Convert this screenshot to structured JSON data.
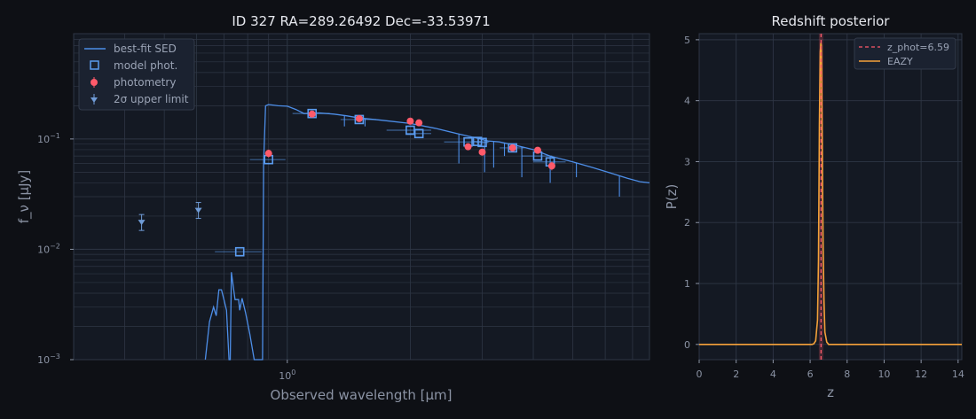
{
  "colors": {
    "background": "#0e1015",
    "axes_bg": "#141923",
    "grid": "#2e3645",
    "text": "#8b93a4",
    "sed": "#4d8ee8",
    "model_phot": "#5b9cf0",
    "photometry": "#ff5a6a",
    "upper_limit": "#6f9bd6",
    "zphot_line": "#ff5a6a",
    "eazy": "#f6a23a"
  },
  "chart_data": [
    {
      "type": "scatter",
      "title": "ID 327  RA=289.26492  Dec=-33.53971",
      "xlabel": "Observed wavelength [µm]",
      "ylabel": "f_ν [µJy]",
      "xscale": "log",
      "yscale": "log",
      "xlim": [
        0.3,
        7.7
      ],
      "ylim": [
        0.001,
        0.9
      ],
      "x_tick_labels": [
        "10^0"
      ],
      "y_tick_labels": [
        "10^-3",
        "10^-2",
        "10^-1"
      ],
      "grid": true,
      "legend": {
        "position": "top-left",
        "entries": [
          "best-fit SED",
          "model phot.",
          "photometry",
          "2σ upper limit"
        ]
      },
      "sed_line": [
        [
          0.63,
          0.001
        ],
        [
          0.645,
          0.0022
        ],
        [
          0.66,
          0.003
        ],
        [
          0.67,
          0.0025
        ],
        [
          0.68,
          0.0043
        ],
        [
          0.69,
          0.0043
        ],
        [
          0.7,
          0.0035
        ],
        [
          0.71,
          0.0028
        ],
        [
          0.72,
          0.001
        ],
        [
          0.725,
          0.001
        ],
        [
          0.73,
          0.0062
        ],
        [
          0.745,
          0.0035
        ],
        [
          0.76,
          0.0035
        ],
        [
          0.765,
          0.0028
        ],
        [
          0.775,
          0.0036
        ],
        [
          0.79,
          0.0027
        ],
        [
          0.81,
          0.0017
        ],
        [
          0.83,
          0.001
        ],
        [
          0.87,
          0.001
        ],
        [
          0.875,
          0.06
        ],
        [
          0.885,
          0.2
        ],
        [
          0.9,
          0.205
        ],
        [
          0.95,
          0.2
        ],
        [
          1.0,
          0.198
        ],
        [
          1.05,
          0.185
        ],
        [
          1.1,
          0.17
        ],
        [
          1.2,
          0.172
        ],
        [
          1.3,
          0.168
        ],
        [
          1.4,
          0.162
        ],
        [
          1.5,
          0.155
        ],
        [
          1.7,
          0.148
        ],
        [
          2.0,
          0.138
        ],
        [
          2.3,
          0.125
        ],
        [
          2.6,
          0.112
        ],
        [
          2.9,
          0.102
        ],
        [
          3.1,
          0.096
        ],
        [
          3.3,
          0.094
        ],
        [
          3.6,
          0.088
        ],
        [
          4.0,
          0.08
        ],
        [
          4.4,
          0.07
        ],
        [
          5.0,
          0.062
        ],
        [
          5.6,
          0.055
        ],
        [
          6.2,
          0.049
        ],
        [
          6.8,
          0.044
        ],
        [
          7.3,
          0.041
        ],
        [
          7.7,
          0.04
        ]
      ],
      "model_phot": [
        {
          "x": 0.765,
          "y": 0.0095,
          "xerr": 0.1
        },
        {
          "x": 0.9,
          "y": 0.065,
          "xerr": 0.09
        },
        {
          "x": 1.15,
          "y": 0.17,
          "xerr": 0.12
        },
        {
          "x": 1.5,
          "y": 0.15,
          "xerr": 0.15
        },
        {
          "x": 2.0,
          "y": 0.12,
          "xerr": 0.25
        },
        {
          "x": 2.1,
          "y": 0.112,
          "xerr": 0.15
        },
        {
          "x": 2.77,
          "y": 0.094,
          "xerr": 0.35
        },
        {
          "x": 2.92,
          "y": 0.095,
          "xerr": 0.08
        },
        {
          "x": 3.0,
          "y": 0.093,
          "xerr": 0.1
        },
        {
          "x": 3.56,
          "y": 0.083,
          "xerr": 0.25
        },
        {
          "x": 4.1,
          "y": 0.07,
          "xerr": 0.35
        },
        {
          "x": 4.4,
          "y": 0.062,
          "xerr": 0.4
        }
      ],
      "photometry": [
        {
          "x": 0.9,
          "y": 0.074,
          "yerr": 0.006
        },
        {
          "x": 1.15,
          "y": 0.168,
          "yerr": 0.006
        },
        {
          "x": 1.5,
          "y": 0.153,
          "yerr": 0.005
        },
        {
          "x": 2.0,
          "y": 0.145,
          "yerr": 0.005
        },
        {
          "x": 2.1,
          "y": 0.14,
          "yerr": 0.005
        },
        {
          "x": 2.77,
          "y": 0.085,
          "yerr": 0.004
        },
        {
          "x": 3.0,
          "y": 0.076,
          "yerr": 0.005
        },
        {
          "x": 3.56,
          "y": 0.083,
          "yerr": 0.004
        },
        {
          "x": 4.1,
          "y": 0.079,
          "yerr": 0.005
        },
        {
          "x": 4.44,
          "y": 0.057,
          "yerr": 0.005
        }
      ],
      "upper_limits": [
        {
          "x": 0.44,
          "y": 0.0175
        },
        {
          "x": 0.606,
          "y": 0.0225
        }
      ]
    },
    {
      "type": "line",
      "title": "Redshift posterior",
      "xlabel": "z",
      "ylabel": "P(z)",
      "xlim": [
        0,
        14.2
      ],
      "ylim": [
        -0.25,
        5.1
      ],
      "x_ticks": [
        0,
        2,
        4,
        6,
        8,
        10,
        12,
        14
      ],
      "y_ticks": [
        0,
        1,
        2,
        3,
        4,
        5
      ],
      "grid": true,
      "legend": {
        "position": "top-right",
        "entries": [
          "z_phot=6.59",
          "EAZY"
        ]
      },
      "z_phot": 6.59,
      "z_band": [
        6.47,
        6.71
      ],
      "series": [
        {
          "name": "EAZY",
          "x": [
            0,
            5,
            6.1,
            6.2,
            6.3,
            6.4,
            6.45,
            6.5,
            6.55,
            6.58,
            6.6,
            6.62,
            6.65,
            6.7,
            6.75,
            6.8,
            6.9,
            7.0,
            7.2,
            14.2
          ],
          "y": [
            0,
            0,
            0.0,
            0.01,
            0.06,
            0.4,
            1.4,
            3.6,
            4.8,
            4.95,
            4.9,
            4.5,
            3.4,
            1.6,
            0.7,
            0.2,
            0.04,
            0.0,
            0,
            0
          ]
        }
      ]
    }
  ]
}
